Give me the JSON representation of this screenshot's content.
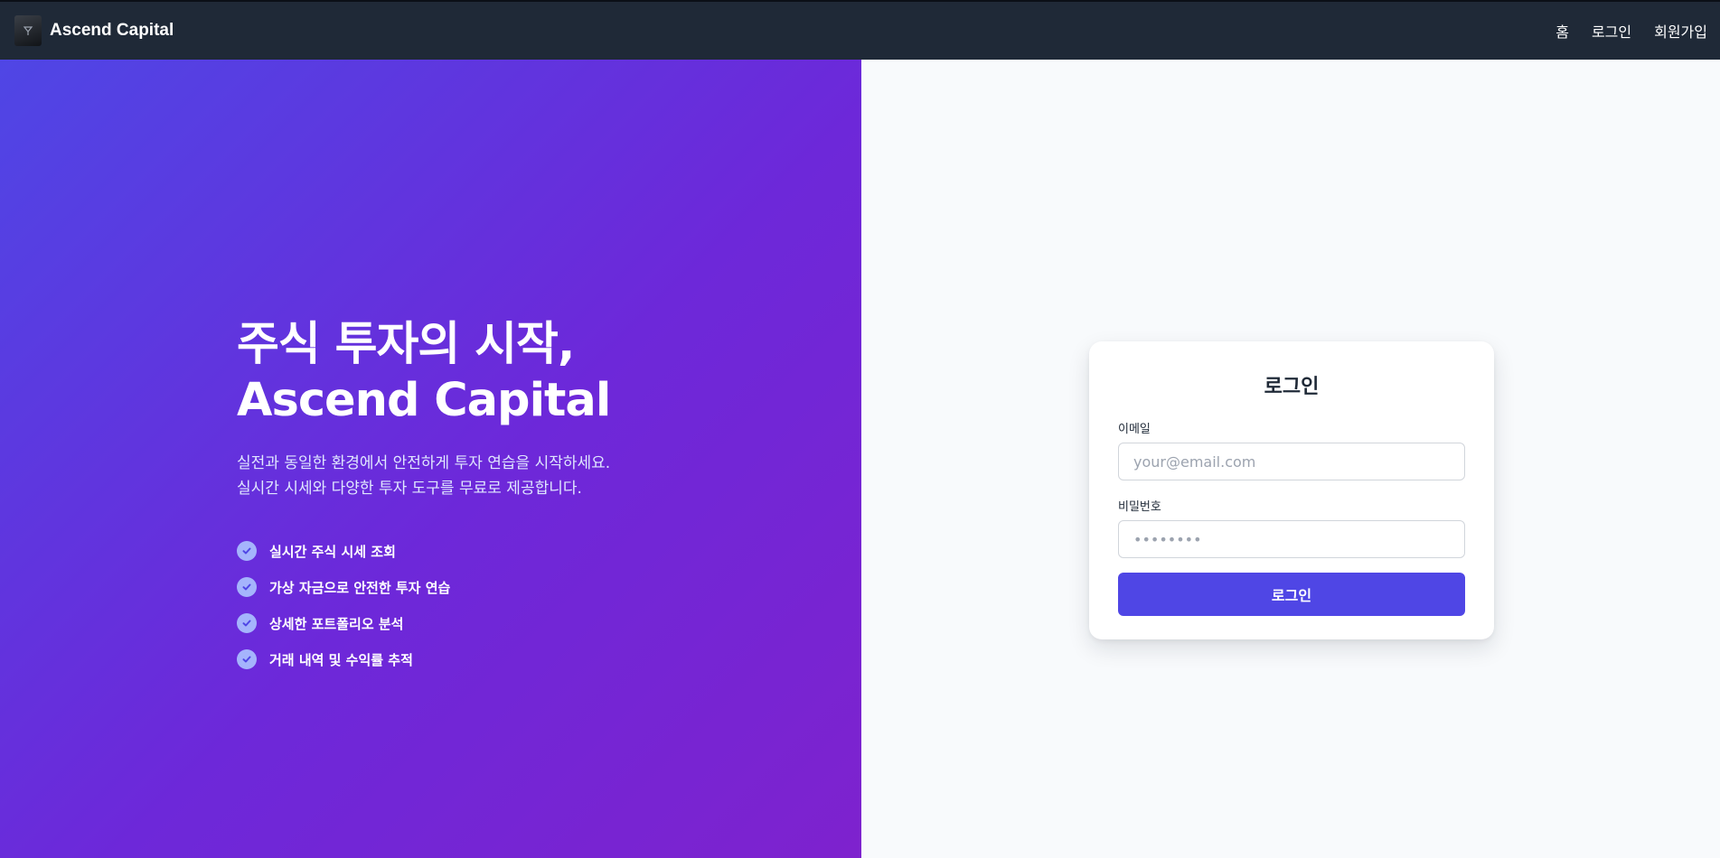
{
  "nav": {
    "brand_name": "Ascend Capital",
    "links": [
      {
        "label": "홈"
      },
      {
        "label": "로그인"
      },
      {
        "label": "회원가입"
      }
    ]
  },
  "hero": {
    "title_line1": "주식 투자의 시작,",
    "title_line2": "Ascend Capital",
    "subtitle_line1": "실전과 동일한 환경에서 안전하게 투자 연습을 시작하세요.",
    "subtitle_line2": "실시간 시세와 다양한 투자 도구를 무료로 제공합니다.",
    "features": [
      "실시간 주식 시세 조회",
      "가상 자금으로 안전한 투자 연습",
      "상세한 포트폴리오 분석",
      "거래 내역 및 수익률 추적"
    ]
  },
  "login": {
    "title": "로그인",
    "email_label": "이메일",
    "email_placeholder": "your@email.com",
    "password_label": "비밀번호",
    "password_placeholder": "••••••••",
    "submit_label": "로그인"
  },
  "colors": {
    "nav_bg": "#1f2937",
    "hero_gradient_start": "#4f46e5",
    "hero_gradient_end": "#7e22ce",
    "primary_button": "#4f46e5",
    "check_icon": "#a5b4fc"
  }
}
